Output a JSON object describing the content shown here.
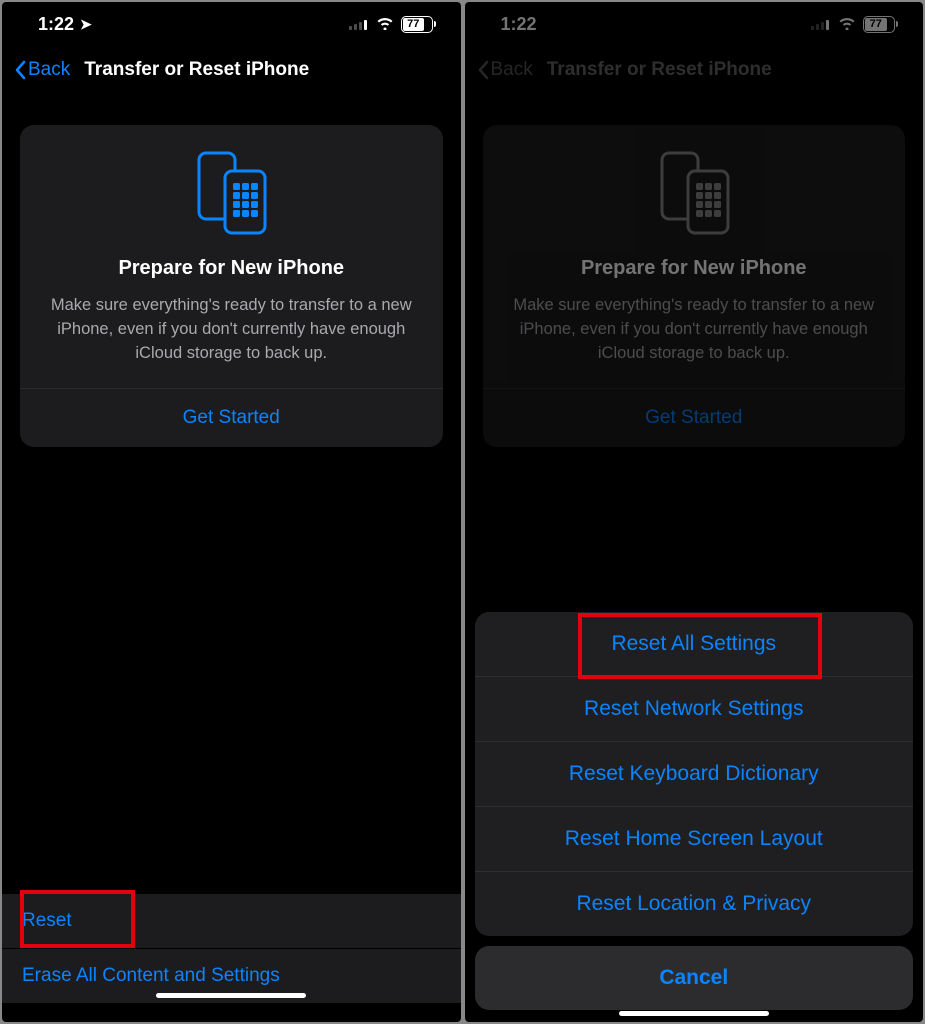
{
  "status": {
    "time": "1:22",
    "battery": "77"
  },
  "nav": {
    "back": "Back",
    "title": "Transfer or Reset iPhone"
  },
  "card": {
    "title": "Prepare for New iPhone",
    "body": "Make sure everything's ready to transfer to a new iPhone, even if you don't currently have enough iCloud storage to back up.",
    "cta": "Get Started"
  },
  "list": {
    "reset": "Reset",
    "erase": "Erase All Content and Settings"
  },
  "sheet": {
    "items": [
      "Reset All Settings",
      "Reset Network Settings",
      "Reset Keyboard Dictionary",
      "Reset Home Screen Layout",
      "Reset Location & Privacy"
    ],
    "cancel": "Cancel"
  },
  "colors": {
    "accent": "#0a84ff",
    "highlight": "#e3000f"
  }
}
